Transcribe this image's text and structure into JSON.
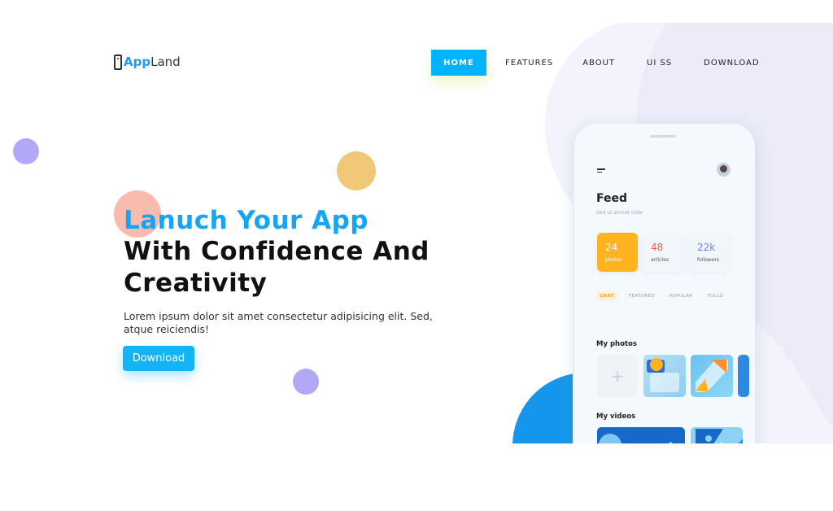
{
  "brand": {
    "name_part1": "App",
    "name_part2": "Land"
  },
  "nav": {
    "items": [
      {
        "label": "HOME",
        "active": true
      },
      {
        "label": "FEATURES"
      },
      {
        "label": "ABOUT"
      },
      {
        "label": "UI SS"
      },
      {
        "label": "DOWNLOAD"
      }
    ]
  },
  "hero": {
    "title_line1": "Lanuch Your App",
    "title_line2": "With Confidence And",
    "title_line3": "Creativity",
    "description": "Lorem ipsum dolor sit amet consectetur adipisicing elit. Sed, atque reiciendis!",
    "cta_label": "Download"
  },
  "phone": {
    "feed_title": "Feed",
    "feed_subtitle": "Sed ut amnet color",
    "stats": [
      {
        "value": "24",
        "label": "photos"
      },
      {
        "value": "48",
        "label": "articles"
      },
      {
        "value": "22k",
        "label": "followers"
      }
    ],
    "tabs": [
      "CHAT",
      "FEATURED",
      "POPULAR",
      "FOLLO"
    ],
    "section_photos": "My photos",
    "section_videos": "My videos",
    "add_symbol": "+"
  },
  "colors": {
    "accent": "#00b4ff",
    "headline_blue": "#14a6f5",
    "stat_orange": "#ffb31f",
    "dot_purple": "#b1a9f7",
    "dot_yellow": "#f0c878",
    "dot_pink": "#f8b4a4"
  },
  "icons": [
    "phone-icon",
    "menu-icon",
    "avatar-icon",
    "plus-icon"
  ]
}
